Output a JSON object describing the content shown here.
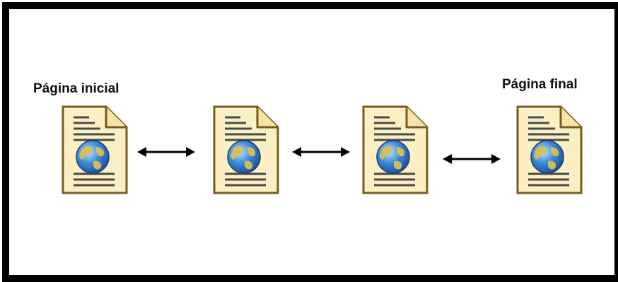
{
  "diagram": {
    "start_label": "Página inicial",
    "end_label": "Página final",
    "pages": [
      {
        "icon": "web-document-icon"
      },
      {
        "icon": "web-document-icon"
      },
      {
        "icon": "web-document-icon"
      },
      {
        "icon": "web-document-icon"
      }
    ],
    "links": [
      {
        "from": 1,
        "to": 2,
        "direction": "bidirectional"
      },
      {
        "from": 2,
        "to": 3,
        "direction": "bidirectional"
      },
      {
        "from": 3,
        "to": 4,
        "direction": "bidirectional"
      }
    ]
  },
  "colors": {
    "frame": "#000000",
    "paper": "#fbf0c4",
    "paper_edge": "#7a5a20",
    "text_lines": "#4a4a4a",
    "globe_ocean": "#3a8ad8",
    "globe_land": "#d8c050",
    "arrow": "#000000"
  }
}
